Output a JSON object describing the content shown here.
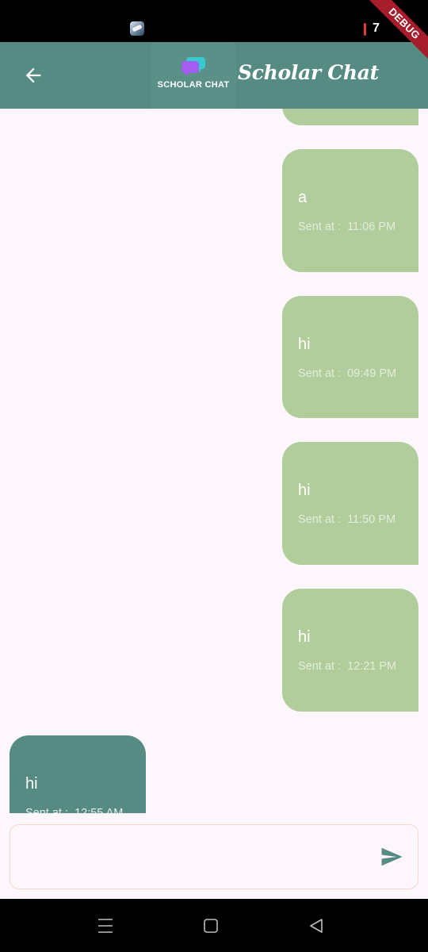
{
  "status_bar": {
    "battery_level": "7"
  },
  "debug_banner": "DEBUG",
  "app_bar": {
    "logo_text": "SCHOLAR CHAT",
    "title": "Scholar Chat"
  },
  "messages": [
    {
      "direction": "sent",
      "text": "",
      "time": ""
    },
    {
      "direction": "sent",
      "text": "a",
      "time": "Sent at :  11:06 PM"
    },
    {
      "direction": "sent",
      "text": "hi",
      "time": "Sent at :  09:49 PM"
    },
    {
      "direction": "sent",
      "text": "hi",
      "time": "Sent at :  11:50 PM"
    },
    {
      "direction": "sent",
      "text": "hi",
      "time": "Sent at :  12:21 PM"
    },
    {
      "direction": "received",
      "text": "hi",
      "time": "Sent at :  12:55 AM"
    }
  ],
  "composer": {
    "value": "",
    "placeholder": ""
  },
  "icons": {
    "back": "arrow-left-icon",
    "send": "send-icon",
    "nav_menu": "menu-icon",
    "nav_home": "square-home-icon",
    "nav_back": "triangle-back-icon"
  },
  "colors": {
    "app_bar": "#558b83",
    "sent_bubble": "#b1cd9b",
    "received_bubble": "#558b83",
    "background": "#fdf7fd",
    "send_icon": "#558b83"
  }
}
